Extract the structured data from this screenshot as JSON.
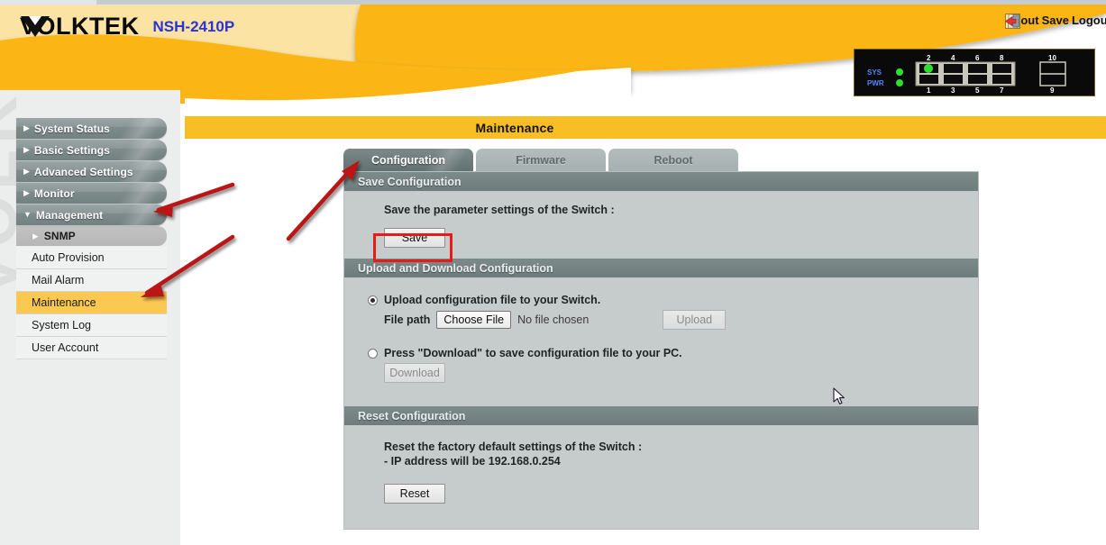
{
  "brand": {
    "logo_text": "VOLKTEK",
    "model": "NSH-2410P",
    "watermark": "VOLKTEK"
  },
  "toolbar": {
    "items": [
      {
        "label": "About",
        "icon": "about-icon"
      },
      {
        "label": "Save",
        "icon": "floppy-disk-icon"
      },
      {
        "label": "Logout",
        "icon": "logout-icon"
      }
    ]
  },
  "device_panel": {
    "sys_label": "SYS",
    "pwr_label": "PWR",
    "port_labels_top": [
      "2",
      "4",
      "6",
      "8",
      "10"
    ],
    "port_labels_bottom": [
      "1",
      "3",
      "5",
      "7",
      "9"
    ],
    "active_port_led": "2"
  },
  "sidebar": {
    "top_items": [
      {
        "label": "System Status",
        "expanded": false,
        "marker": "▶"
      },
      {
        "label": "Basic Settings",
        "expanded": false,
        "marker": "▶"
      },
      {
        "label": "Advanced Settings",
        "expanded": false,
        "marker": "▶"
      },
      {
        "label": "Monitor",
        "expanded": false,
        "marker": "▶"
      },
      {
        "label": "Management",
        "expanded": true,
        "marker": "▼"
      }
    ],
    "sub_item": {
      "label": "SNMP",
      "marker": "▶"
    },
    "leaf_items": [
      {
        "label": "Auto Provision",
        "active": false
      },
      {
        "label": "Mail Alarm",
        "active": false
      },
      {
        "label": "Maintenance",
        "active": true
      },
      {
        "label": "System Log",
        "active": false
      },
      {
        "label": "User Account",
        "active": false
      }
    ]
  },
  "page": {
    "title": "Maintenance"
  },
  "tabs": [
    {
      "label": "Configuration",
      "active": true
    },
    {
      "label": "Firmware",
      "active": false
    },
    {
      "label": "Reboot",
      "active": false
    }
  ],
  "sections": {
    "save_config": {
      "heading": "Save Configuration",
      "description": "Save the parameter settings of the Switch :",
      "button_label": "Save"
    },
    "upload_download": {
      "heading": "Upload and Download Configuration",
      "upload_option_label": "Upload configuration file to your Switch.",
      "file_path_label": "File path",
      "choose_file_label": "Choose File",
      "no_file_text": "No file chosen",
      "upload_button_label": "Upload",
      "download_option_label": "Press \"Download\" to save configuration file to your PC.",
      "download_button_label": "Download",
      "selected_option": "upload"
    },
    "reset_config": {
      "heading": "Reset Configuration",
      "description_line1": "Reset the factory default settings of the Switch :",
      "description_line2": "- IP address will be 192.168.0.254",
      "button_label": "Reset"
    }
  },
  "annotations": {
    "highlight_color": "#e81b1b",
    "arrow_color": "#bb1414",
    "arrows": [
      {
        "name": "arrow-to-management-menu",
        "target": "Management sidebar item"
      },
      {
        "name": "arrow-to-maintenance-menu",
        "target": "Maintenance sidebar item"
      },
      {
        "name": "arrow-to-configuration-tab",
        "target": "Configuration tab"
      }
    ],
    "highlight_box": {
      "name": "save-button-highlight",
      "target": "Save button"
    }
  },
  "colors": {
    "brand_yellow": "#f8be23",
    "header_light_yellow": "#fbe3a4",
    "model_blue": "#2b33d6",
    "panel_bg": "#c6cccc",
    "section_head": "#6e7c7c",
    "active_tab": "#6d7b7b",
    "inactive_tab": "#a7b0b0",
    "active_menu": "#fbc852"
  }
}
